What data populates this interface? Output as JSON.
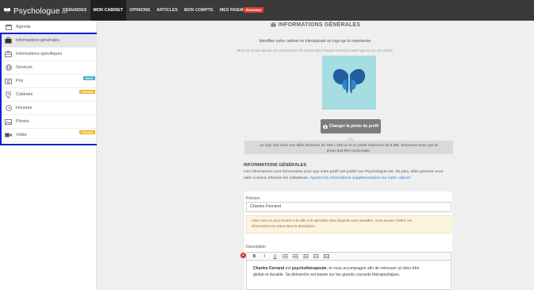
{
  "brand": {
    "name": "Psychologue",
    "suffix": ".net"
  },
  "nav": {
    "items": [
      {
        "label": "DEMANDES",
        "active": false
      },
      {
        "label": "MON CABINET",
        "active": true
      },
      {
        "label": "OPINIONS",
        "active": false
      },
      {
        "label": "ARTICLES",
        "active": false
      },
      {
        "label": "MON COMPTE",
        "active": false
      },
      {
        "label": "MES PAIEMENTS",
        "active": false
      }
    ],
    "badge": "Nouveau"
  },
  "sidebar": {
    "items": [
      {
        "label": "Agenda",
        "icon": "calendar-icon",
        "active": false,
        "badge": ""
      },
      {
        "label": "Informations générales",
        "icon": "briefcase-icon",
        "active": true,
        "badge": ""
      },
      {
        "label": "Informations spécifiques",
        "icon": "briefcase-outline-icon",
        "active": false,
        "badge": ""
      },
      {
        "label": "Services",
        "icon": "globe-icon",
        "active": false,
        "badge": ""
      },
      {
        "label": "Prix",
        "icon": "money-icon",
        "active": false,
        "badge": "BASIC"
      },
      {
        "label": "Cabinets",
        "icon": "map-pin-icon",
        "active": false,
        "badge": "PREMIUM"
      },
      {
        "label": "Horaires",
        "icon": "clock-icon",
        "active": false,
        "badge": ""
      },
      {
        "label": "Photos",
        "icon": "image-icon",
        "active": false,
        "badge": ""
      },
      {
        "label": "Vidéo",
        "icon": "video-icon",
        "active": false,
        "badge": "PREMIUM"
      }
    ],
    "badge_colors": {
      "BASIC": "#3fa8c9",
      "PREMIUM": "#e9b11b"
    }
  },
  "main": {
    "section_title": "INFORMATIONS GÉNÉRALES",
    "intro": "Identifiez votre cabinet en introduisant un logo qui le représente.",
    "note": "Merci de ne pas ajouter vos coordonnées de contact dans l'espace réservé à votre logo ou sur vos photos.",
    "change_photo_label": "Changer la photo de profil",
    "logo_tip_line1": "Le logo doit avoir une taille minimum de 168 x 126 px et un poids maximum de 5 MB. Souvenez-vous que la",
    "logo_tip_line2": "photo doit être horizontale.",
    "info_heading": "INFORMATIONS GÉNÉRALES",
    "info_text": "Ces informations sont nécessaires pour que votre profil soit publié sur Psychologue.net. De plus, elles peuvent vous aider à mieux informer les utilisateurs.",
    "info_link": "Ajoutez les informations supplémentaires sur votre cabinet",
    "prenom_label": "Prénom",
    "prenom_value": "Charles Ferrand",
    "warning_line1": "Votre nom ne peut inclure ni la ville ni la spécialité dans laquelle vous travaillez. Vous pouvez mettre ces",
    "warning_line2": "informations en avant dans la description.",
    "description_label": "Description",
    "description": {
      "name": "Charles Ferrand",
      "mid1": " est ",
      "role": "psychothérapeute",
      "mid2": ", et vous accompagne afin de retrouver un bien-être",
      "line2": "global et durable. Sa démarche est basée sur les grands courants thérapeutiques."
    },
    "toolbar": [
      "B",
      "I",
      "U",
      "list-ul",
      "list-ol",
      "indent-less",
      "indent-more",
      "clear-format"
    ]
  },
  "colors": {
    "topbar": "#3a3a3a",
    "logo_bg": "#a6dde1",
    "highlight": "#1a1ad6",
    "link": "#2a7ec9"
  }
}
